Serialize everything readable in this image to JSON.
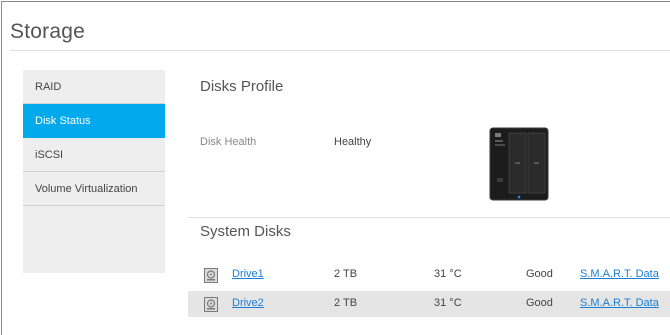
{
  "page": {
    "title": "Storage"
  },
  "sidebar": {
    "items": [
      {
        "label": "RAID",
        "active": false
      },
      {
        "label": "Disk Status",
        "active": true
      },
      {
        "label": "iSCSI",
        "active": false
      },
      {
        "label": "Volume Virtualization",
        "active": false
      }
    ]
  },
  "disks_profile": {
    "title": "Disks Profile",
    "health_label": "Disk Health",
    "health_value": "Healthy",
    "device_icon": "nas-device-image"
  },
  "system_disks": {
    "title": "System Disks",
    "rows": [
      {
        "icon": "hard-drive-icon",
        "name": "Drive1",
        "size": "2 TB",
        "temp": "31 °C",
        "status": "Good",
        "smart": "S.M.A.R.T. Data"
      },
      {
        "icon": "hard-drive-icon",
        "name": "Drive2",
        "size": "2 TB",
        "temp": "31 °C",
        "status": "Good",
        "smart": "S.M.A.R.T. Data"
      }
    ]
  },
  "colors": {
    "accent": "#00a9ec",
    "link": "#1a7fd4",
    "sidebar_bg": "#eeeeee",
    "row_alt": "#e5e5e5"
  }
}
